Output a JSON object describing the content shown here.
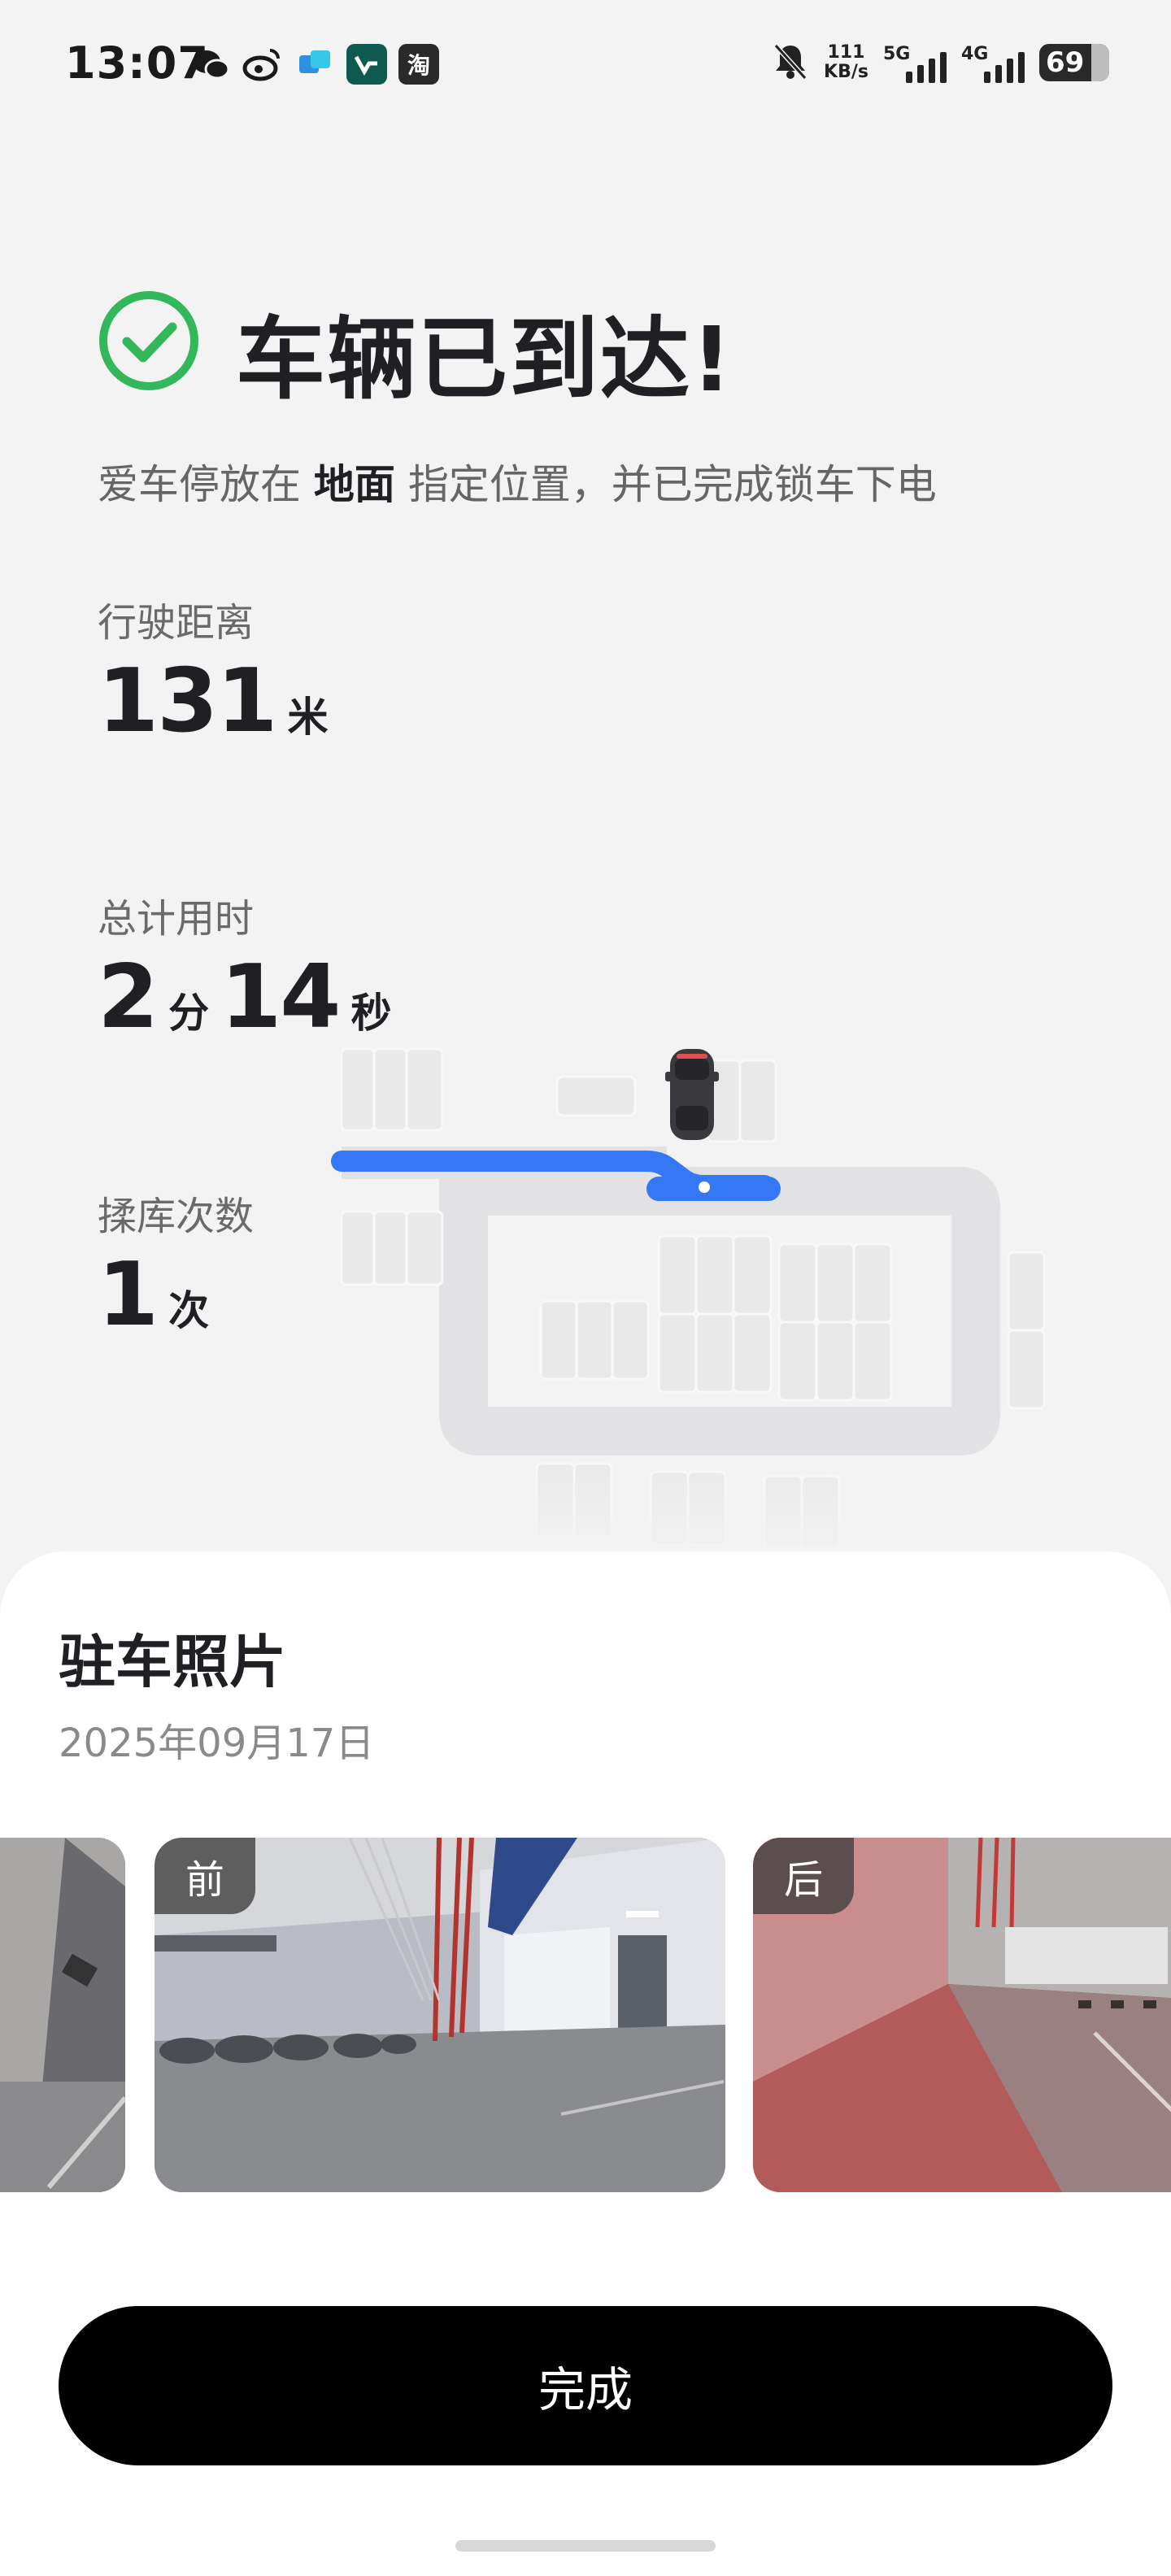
{
  "status_bar": {
    "time": "13:07",
    "apps": [
      {
        "icon": "wechat-icon",
        "glyph": "●",
        "color": "#1a1a1a"
      },
      {
        "icon": "weibo-icon",
        "glyph": "◉",
        "color": "#1a1a1a"
      },
      {
        "icon": "app-blue-icon",
        "glyph": "◆",
        "color": "#2f8fe0"
      },
      {
        "icon": "app-teal-icon",
        "glyph": "◣",
        "color": "#0f5a4f"
      },
      {
        "icon": "taobao-icon",
        "glyph": "淘",
        "color": "#2a2a2a"
      }
    ],
    "net_speed_value": "111",
    "net_speed_unit": "KB/s",
    "signal_1_label": "5G",
    "signal_2_label": "4G",
    "battery": "69"
  },
  "hero": {
    "title": "车辆已到达!",
    "subtitle_prefix": "爱车停放在",
    "subtitle_place": "地面",
    "subtitle_suffix": "指定位置，并已完成锁车下电"
  },
  "stats": [
    {
      "label": "行驶距离",
      "value": "131",
      "unit": "米"
    },
    {
      "label": "总计用时",
      "minutes": "2",
      "minutes_unit": "分",
      "seconds": "14",
      "seconds_unit": "秒"
    },
    {
      "label": "揉库次数",
      "value": "1",
      "unit": "次"
    }
  ],
  "sheet": {
    "title": "驻车照片",
    "date": "2025年09月17日",
    "photos": [
      {
        "tag": ""
      },
      {
        "tag": "前"
      },
      {
        "tag": "后"
      }
    ],
    "done_label": "完成"
  },
  "colors": {
    "accent_green": "#32b85a",
    "route_blue": "#3478f6",
    "button_black": "#000000"
  }
}
